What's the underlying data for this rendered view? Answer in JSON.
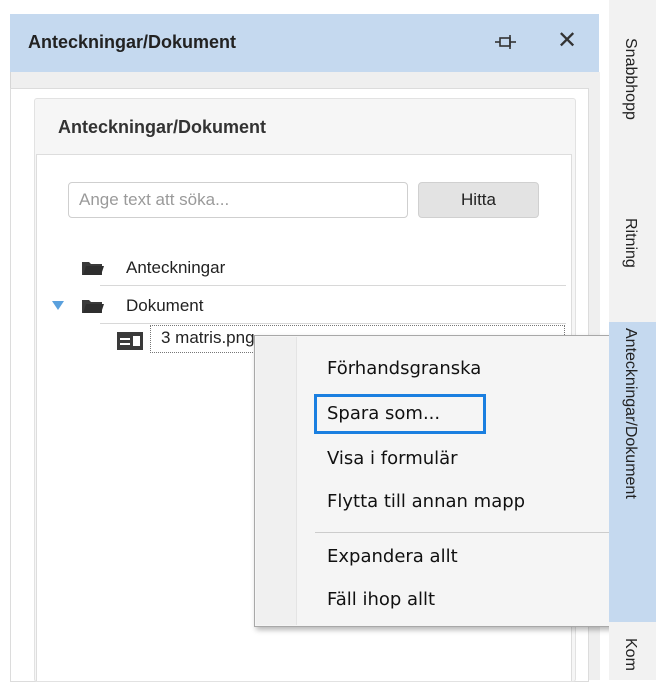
{
  "panel": {
    "title": "Anteckningar/Dokument"
  },
  "card": {
    "title": "Anteckningar/Dokument"
  },
  "search": {
    "placeholder": "Ange text att söka...",
    "button_label": "Hitta"
  },
  "tree": {
    "folders": [
      {
        "label": "Anteckningar",
        "expanded": false
      },
      {
        "label": "Dokument",
        "expanded": true
      }
    ],
    "file": {
      "label": "3 matris.png"
    }
  },
  "context_menu": {
    "items": [
      {
        "label": "Förhandsgranska"
      },
      {
        "label": "Spara som..."
      },
      {
        "label": "Visa i formulär"
      },
      {
        "label": "Flytta till annan mapp"
      },
      {
        "label": "Expandera allt"
      },
      {
        "label": "Fäll ihop allt"
      }
    ],
    "highlighted_item": "Spara som..."
  },
  "side_tabs": [
    {
      "label": "Snabbhopp"
    },
    {
      "label": "Ritning"
    },
    {
      "label": "Anteckningar/Dokument",
      "active": true
    },
    {
      "label": "Kom"
    }
  ],
  "colors": {
    "header_bg": "#c5d9ef",
    "highlight": "#1a7fe0",
    "folder_icon": "#3a3a3a"
  }
}
